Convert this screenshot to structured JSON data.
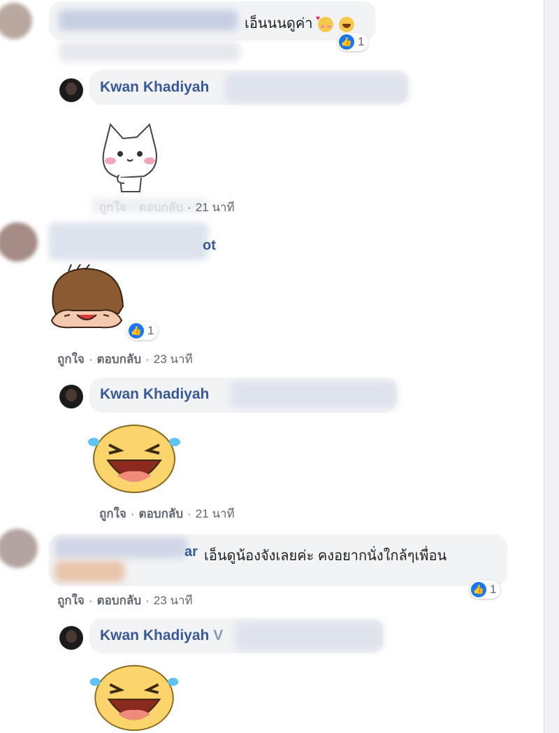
{
  "comments": [
    {
      "text": "เอ็นนนดูค่า",
      "emoji_icons": [
        "smiling-face-with-hearts-icon",
        "grinning-squinting-face-icon"
      ],
      "reaction_count": "1"
    },
    {
      "reply_author": "Kwan Khadiyah",
      "sticker": "white-cat-sticker",
      "meta": {
        "like": "ถูกใจ",
        "reply": "ตอบกลับ",
        "time": "21 นาที"
      }
    },
    {
      "name_fragment": "ot",
      "sticker": "crying-girl-sticker",
      "reaction_count": "1",
      "meta": {
        "like": "ถูกใจ",
        "reply": "ตอบกลับ",
        "time": "23 นาที"
      }
    },
    {
      "reply_author": "Kwan Khadiyah",
      "sticker": "laughing-tears-sticker",
      "meta": {
        "like": "ถูกใจ",
        "reply": "ตอบกลับ",
        "time": "21 นาที"
      }
    },
    {
      "name_fragment": "ar",
      "text": "เอ็นดูน้องจังเลยค่ะ คงอยากนั่งใกล้ๆเพื่อน",
      "reaction_count": "1",
      "meta": {
        "like": "ถูกใจ",
        "reply": "ตอบกลับ",
        "time": "23 นาที"
      }
    },
    {
      "reply_author": "Kwan Khadiyah",
      "name_suffix": "V",
      "sticker": "laughing-tears-sticker"
    }
  ],
  "colors": {
    "link": "#385898",
    "meta": "#606770",
    "bubble": "#f2f3f5",
    "like": "#1877f2"
  }
}
